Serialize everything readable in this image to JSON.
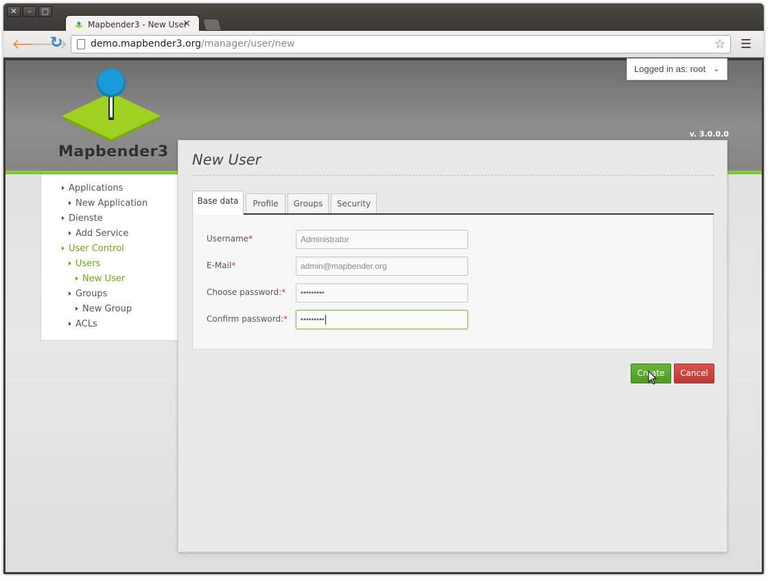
{
  "browser": {
    "tab_title": "Mapbender3 - New User",
    "tab_close": "✕",
    "url_host": "demo.mapbender3.org",
    "url_path": "/manager/user/new",
    "back_icon": "back-arrow-icon",
    "forward_icon": "forward-arrow-icon",
    "reload_icon": "reload-icon",
    "star_icon": "bookmark-star-icon",
    "menu_icon": "hamburger-menu-icon",
    "window_buttons": [
      "✕",
      "–",
      "□"
    ]
  },
  "header": {
    "logo_text": "Mapbender3",
    "version": "v. 3.0.0.0",
    "user_menu_label": "Logged in as: root",
    "colors": {
      "accent": "#76c02b",
      "logo_green": "#9ed122",
      "logo_blue": "#1a9ad6"
    }
  },
  "sidebar": {
    "items": [
      {
        "label": "Applications",
        "level": 0,
        "active": false
      },
      {
        "label": "New Application",
        "level": 1,
        "active": false
      },
      {
        "label": "Dienste",
        "level": 0,
        "active": false
      },
      {
        "label": "Add Service",
        "level": 1,
        "active": false
      },
      {
        "label": "User Control",
        "level": 0,
        "active": true
      },
      {
        "label": "Users",
        "level": 1,
        "active": true
      },
      {
        "label": "New User",
        "level": 2,
        "active": true
      },
      {
        "label": "Groups",
        "level": 1,
        "active": false
      },
      {
        "label": "New Group",
        "level": 2,
        "active": false
      },
      {
        "label": "ACLs",
        "level": 1,
        "active": false
      }
    ]
  },
  "main": {
    "title": "New User",
    "tabs": [
      {
        "label": "Base data",
        "active": true
      },
      {
        "label": "Profile",
        "active": false
      },
      {
        "label": "Groups",
        "active": false
      },
      {
        "label": "Security",
        "active": false
      }
    ],
    "form": {
      "required_marker": "*",
      "fields": [
        {
          "label": "Username",
          "value": "Administrator"
        },
        {
          "label": "E-Mail",
          "value": "admin@mapbender.org"
        },
        {
          "label": "Choose password:",
          "value": "•••••••••"
        },
        {
          "label": "Confirm password:",
          "value": "•••••••••"
        }
      ]
    },
    "buttons": {
      "create": "Create",
      "cancel": "Cancel"
    }
  }
}
